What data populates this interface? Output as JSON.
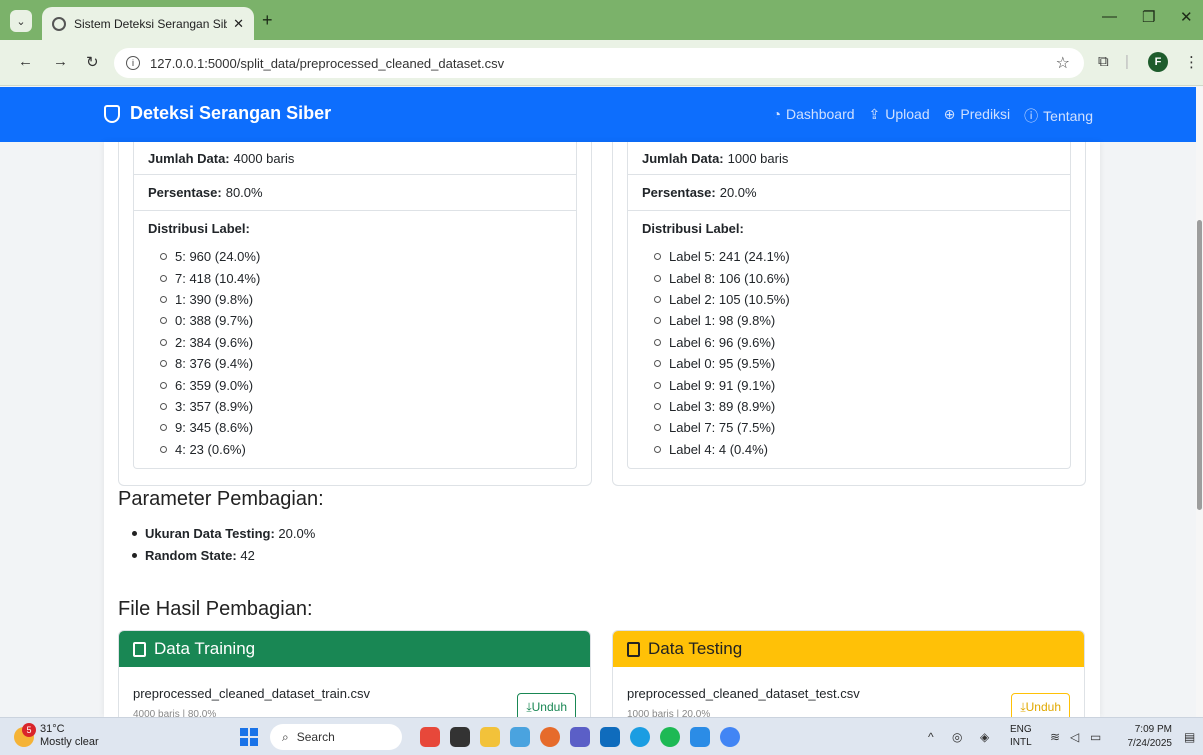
{
  "browser": {
    "tab_title": "Sistem Deteksi Serangan Siber",
    "url": "127.0.0.1:5000/split_data/preprocessed_cleaned_dataset.csv",
    "profile_initial": "F"
  },
  "navbar": {
    "brand": "Deteksi Serangan Siber",
    "links": [
      "Dashboard",
      "Upload",
      "Prediksi",
      "Tentang"
    ]
  },
  "train": {
    "count_label": "Jumlah Data:",
    "count_value": "4000 baris",
    "pct_label": "Persentase:",
    "pct_value": "80.0%",
    "dist_label": "Distribusi Label:",
    "dist": [
      "5: 960 (24.0%)",
      "7: 418 (10.4%)",
      "1: 390 (9.8%)",
      "0: 388 (9.7%)",
      "2: 384 (9.6%)",
      "8: 376 (9.4%)",
      "6: 359 (9.0%)",
      "3: 357 (8.9%)",
      "9: 345 (8.6%)",
      "4: 23 (0.6%)"
    ]
  },
  "test": {
    "count_label": "Jumlah Data:",
    "count_value": "1000 baris",
    "pct_label": "Persentase:",
    "pct_value": "20.0%",
    "dist_label": "Distribusi Label:",
    "dist": [
      "Label 5: 241 (24.1%)",
      "Label 8: 106 (10.6%)",
      "Label 2: 105 (10.5%)",
      "Label 1: 98 (9.8%)",
      "Label 6: 96 (9.6%)",
      "Label 0: 95 (9.5%)",
      "Label 9: 91 (9.1%)",
      "Label 3: 89 (8.9%)",
      "Label 7: 75 (7.5%)",
      "Label 4: 4 (0.4%)"
    ]
  },
  "params": {
    "title": "Parameter Pembagian:",
    "test_size_label": "Ukuran Data Testing:",
    "test_size_value": "20.0%",
    "random_state_label": "Random State:",
    "random_state_value": "42"
  },
  "files": {
    "title": "File Hasil Pembagian:",
    "train_header": "Data Training",
    "train_file": "preprocessed_cleaned_dataset_train.csv",
    "train_meta": "4000 baris | 80.0%",
    "test_header": "Data Testing",
    "test_file": "preprocessed_cleaned_dataset_test.csv",
    "test_meta": "1000 baris | 20.0%",
    "download": "Unduh"
  },
  "taskbar": {
    "temp": "31°C",
    "weather": "Mostly clear",
    "weather_badge": "5",
    "search": "Search",
    "lang1": "ENG",
    "lang2": "INTL",
    "time": "7:09 PM",
    "date": "7/24/2025"
  },
  "colors": {
    "primary": "#0d6efd",
    "train_header": "#198754",
    "test_header": "#ffc107"
  }
}
